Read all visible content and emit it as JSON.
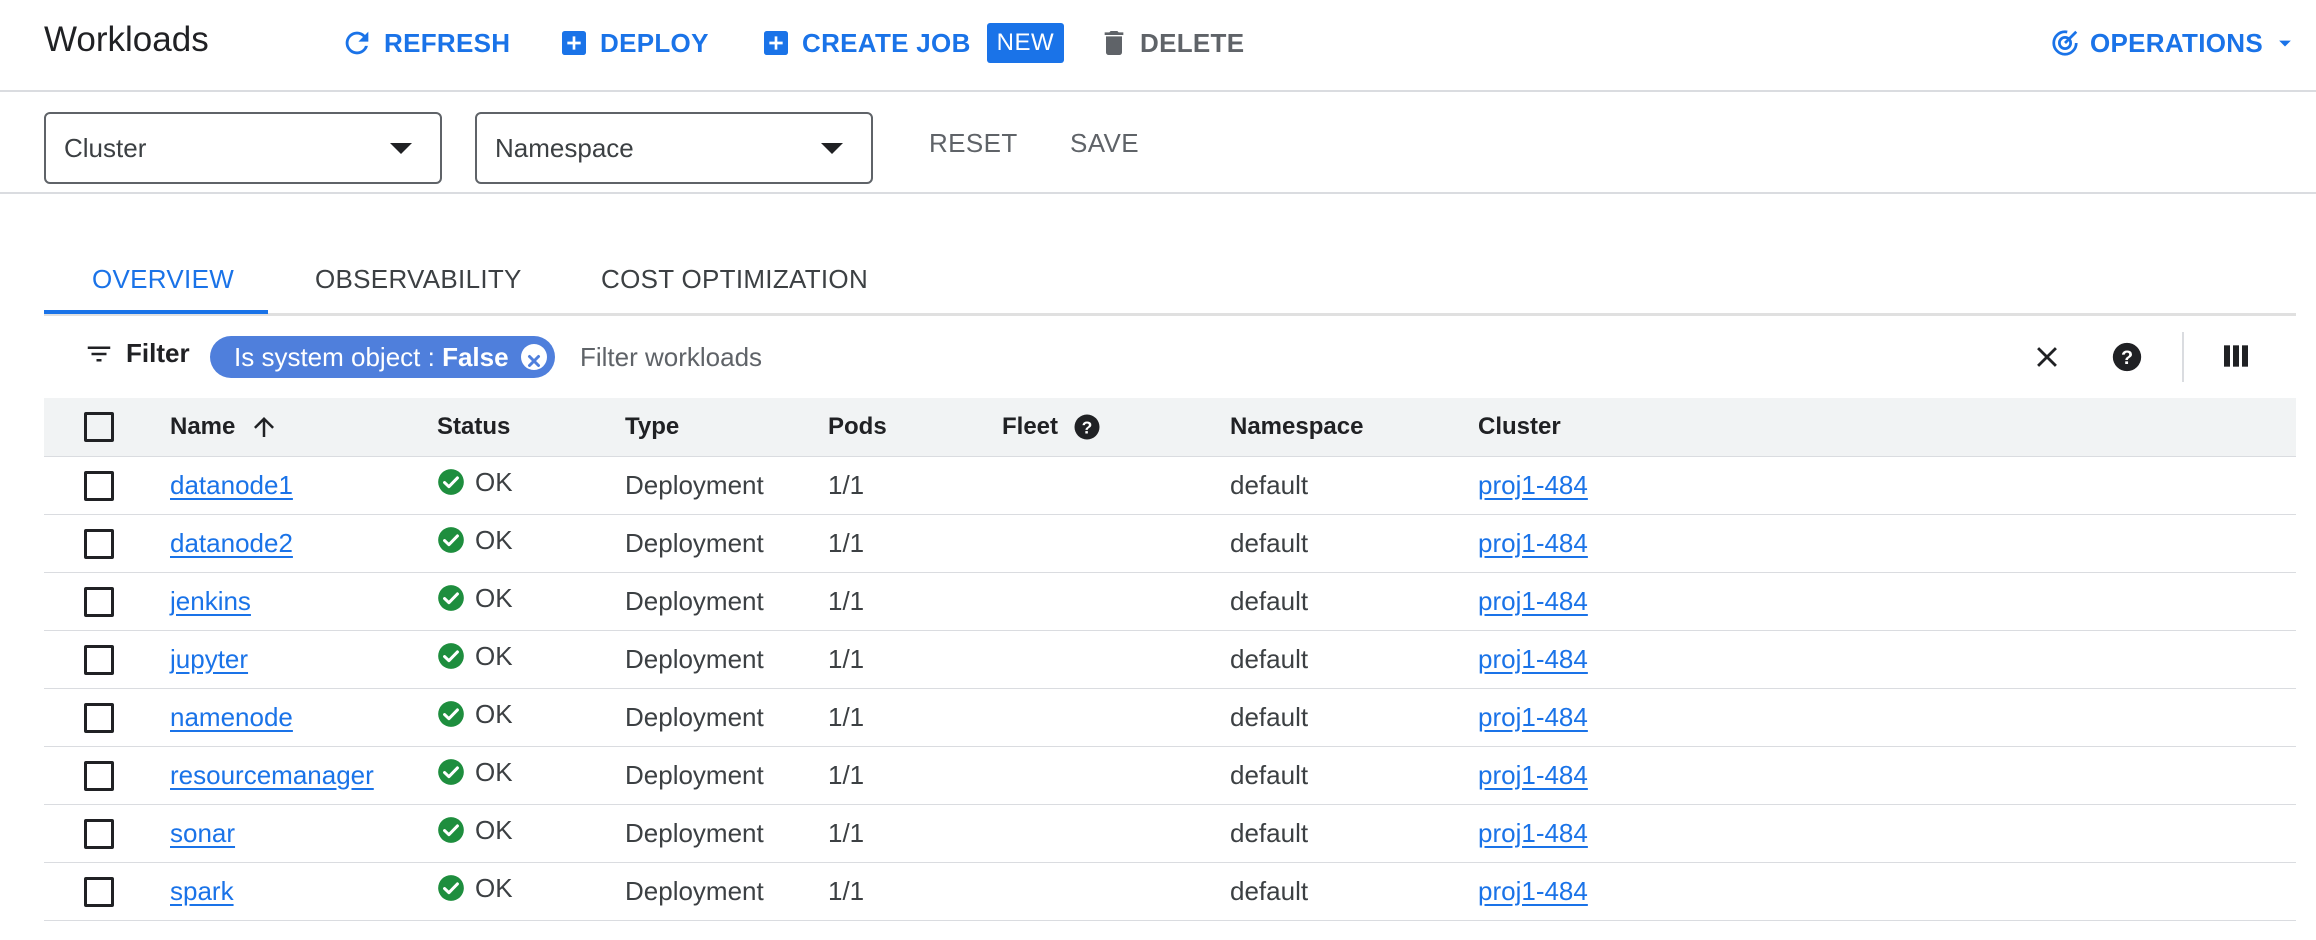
{
  "header": {
    "title": "Workloads",
    "refresh_label": "REFRESH",
    "deploy_label": "DEPLOY",
    "create_job_label": "CREATE JOB",
    "new_badge": "NEW",
    "delete_label": "DELETE",
    "operations_label": "OPERATIONS"
  },
  "filters": {
    "cluster_label": "Cluster",
    "namespace_label": "Namespace",
    "reset_label": "RESET",
    "save_label": "SAVE"
  },
  "tabs": [
    {
      "label": "OVERVIEW",
      "active": true
    },
    {
      "label": "OBSERVABILITY",
      "active": false
    },
    {
      "label": "COST OPTIMIZATION",
      "active": false
    }
  ],
  "filter_row": {
    "filter_label": "Filter",
    "chip_key": "Is system object : ",
    "chip_value": "False",
    "placeholder": "Filter workloads"
  },
  "table": {
    "columns": [
      "Name",
      "Status",
      "Type",
      "Pods",
      "Fleet",
      "Namespace",
      "Cluster"
    ],
    "rows": [
      {
        "name": "datanode1",
        "status": "OK",
        "type": "Deployment",
        "pods": "1/1",
        "fleet": "",
        "namespace": "default",
        "cluster": "proj1-484"
      },
      {
        "name": "datanode2",
        "status": "OK",
        "type": "Deployment",
        "pods": "1/1",
        "fleet": "",
        "namespace": "default",
        "cluster": "proj1-484"
      },
      {
        "name": "jenkins",
        "status": "OK",
        "type": "Deployment",
        "pods": "1/1",
        "fleet": "",
        "namespace": "default",
        "cluster": "proj1-484"
      },
      {
        "name": "jupyter",
        "status": "OK",
        "type": "Deployment",
        "pods": "1/1",
        "fleet": "",
        "namespace": "default",
        "cluster": "proj1-484"
      },
      {
        "name": "namenode",
        "status": "OK",
        "type": "Deployment",
        "pods": "1/1",
        "fleet": "",
        "namespace": "default",
        "cluster": "proj1-484"
      },
      {
        "name": "resourcemanager",
        "status": "OK",
        "type": "Deployment",
        "pods": "1/1",
        "fleet": "",
        "namespace": "default",
        "cluster": "proj1-484"
      },
      {
        "name": "sonar",
        "status": "OK",
        "type": "Deployment",
        "pods": "1/1",
        "fleet": "",
        "namespace": "default",
        "cluster": "proj1-484"
      },
      {
        "name": "spark",
        "status": "OK",
        "type": "Deployment",
        "pods": "1/1",
        "fleet": "",
        "namespace": "default",
        "cluster": "proj1-484"
      }
    ]
  },
  "icons": {
    "refresh": "refresh-icon",
    "deploy": "add-box-icon",
    "create_job": "add-box-icon",
    "delete": "trash-icon",
    "operations": "operations-icon",
    "filter": "filter-list-icon",
    "clear": "close-icon",
    "help": "help-icon",
    "columns": "column-display-icon",
    "sort": "arrow-up-icon",
    "status_ok": "check-circle-icon"
  },
  "colors": {
    "accent": "#1a73e8",
    "chip": "#4f7fdc",
    "ok_green": "#1e8e3e"
  }
}
